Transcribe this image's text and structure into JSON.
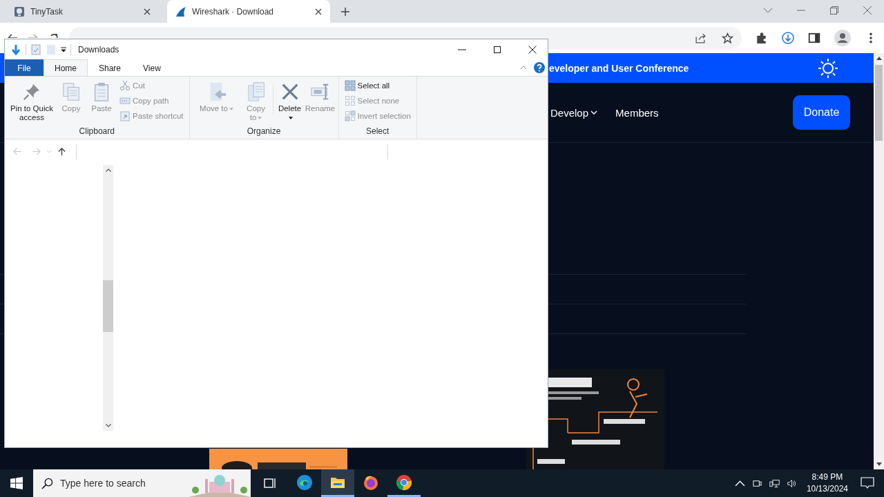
{
  "browser": {
    "tabs": [
      {
        "title": "TinyTask",
        "selected": false
      },
      {
        "title": "Wireshark · Download",
        "selected": true
      }
    ],
    "page": {
      "banner": "eveloper and User Conference",
      "nav": [
        {
          "label": "Develop",
          "dropdown": true
        },
        {
          "label": "Members",
          "dropdown": false
        }
      ],
      "donate": "Donate"
    }
  },
  "explorer": {
    "title": "Downloads",
    "ribbon_tabs": [
      {
        "label": "File",
        "kind": "file",
        "selected": false
      },
      {
        "label": "Home",
        "kind": "tab",
        "selected": true
      },
      {
        "label": "Share",
        "kind": "tab",
        "selected": false
      },
      {
        "label": "View",
        "kind": "tab",
        "selected": false
      }
    ],
    "groups": [
      {
        "name": "Clipboard",
        "large": [
          {
            "label": "Pin to Quick access",
            "disabled": false,
            "dropdown": false
          },
          {
            "label": "Copy",
            "disabled": true,
            "dropdown": false
          },
          {
            "label": "Paste",
            "disabled": true,
            "dropdown": false
          }
        ],
        "small": [
          {
            "label": "Cut",
            "disabled": true
          },
          {
            "label": "Copy path",
            "disabled": true
          },
          {
            "label": "Paste shortcut",
            "disabled": true
          }
        ]
      },
      {
        "name": "Organize",
        "large": [
          {
            "label": "Move to",
            "disabled": true,
            "dropdown": true
          },
          {
            "label": "Copy to",
            "disabled": true,
            "dropdown": true
          },
          {
            "label": "Delete",
            "disabled": false,
            "dropdown": true
          },
          {
            "label": "Rename",
            "disabled": true,
            "dropdown": false
          }
        ]
      },
      {
        "name": "Select",
        "small": [
          {
            "label": "Select all",
            "disabled": false
          },
          {
            "label": "Select none",
            "disabled": true
          },
          {
            "label": "Invert selection",
            "disabled": true
          }
        ]
      }
    ]
  },
  "taskbar": {
    "search_placeholder": "Type here to search",
    "apps": [
      {
        "selected": false,
        "running": false
      },
      {
        "selected": true,
        "running": true
      },
      {
        "selected": false,
        "running": false
      },
      {
        "selected": false,
        "running": true
      }
    ],
    "time": "8:49 PM",
    "date": "10/13/2024"
  }
}
